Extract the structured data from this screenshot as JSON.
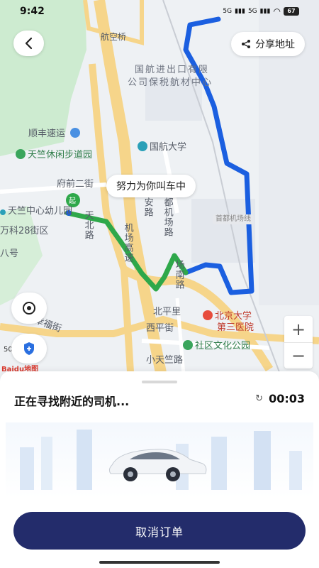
{
  "status_bar": {
    "time": "9:42",
    "network1": "5G",
    "network2": "5G",
    "battery": "67"
  },
  "header": {
    "share_label": "分享地址"
  },
  "map": {
    "callout": "努力为你叫车中",
    "origin_badge": "起",
    "labels": {
      "hangkongqiao": "航空桥",
      "company1": "国航进出口有限",
      "company2": "公司保税航材中心",
      "shunfeng": "顺丰速运",
      "tianzhu_park": "天竺休闲步道园",
      "cauc": "国航大学",
      "fuqian": "府前二街",
      "tianzhu_kinder": "天竺中心幼儿园",
      "wanke": "万科28街区",
      "baho": "八号",
      "tianbei": "天北路",
      "jichang_gao": "机场高速",
      "anlu": "安路",
      "dujichang": "都机场路",
      "shoudu_line": "首都机场线",
      "nanlu": "场南路",
      "beipingli": "北平里",
      "hospital1": "北京大学",
      "hospital2": "第三医院",
      "xipingjie": "西平街",
      "xingfujie": "幸福街",
      "community_park": "社区文化公园",
      "xiaotianzhu": "小天竺路"
    },
    "scale": "50",
    "provider": "Baidu地图"
  },
  "sheet": {
    "status": "正在寻找附近的司机...",
    "timer": "00:03",
    "cancel_label": "取消订单"
  },
  "colors": {
    "route_blue": "#1b5fe0",
    "route_green": "#2ea84a",
    "primary_button": "#232c6b",
    "road_yellow": "#f6d58a",
    "park_green": "#cdebd0"
  }
}
